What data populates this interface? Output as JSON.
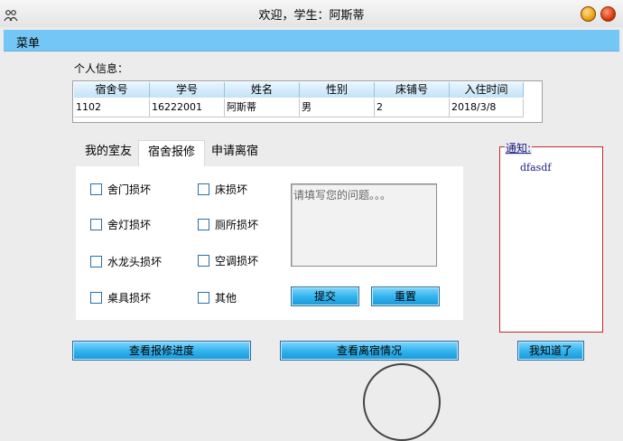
{
  "window": {
    "title": "欢迎，学生：阿斯蒂"
  },
  "menu": {
    "label": "菜单"
  },
  "personal_info": {
    "label": "个人信息：",
    "columns": [
      "宿舍号",
      "学号",
      "姓名",
      "性别",
      "床铺号",
      "入住时间"
    ],
    "row": [
      "1102",
      "16222001",
      "阿斯蒂",
      "男",
      "2",
      "2018/3/8"
    ]
  },
  "tabs": [
    "我的室友",
    "宿舍报修",
    "申请离宿"
  ],
  "active_tab": 1,
  "repair_options": [
    "舍门损坏",
    "床损坏",
    "舍灯损坏",
    "厕所损坏",
    "水龙头损坏",
    "空调损坏",
    "桌具损坏",
    "其他"
  ],
  "problem_input": {
    "placeholder": "请填写您的问题。。。"
  },
  "buttons": {
    "submit": "提交",
    "reset": "重置",
    "view_repair": "查看报修进度",
    "view_leave": "查看离宿情况",
    "acknowledge": "我知道了"
  },
  "notice": {
    "title": "通知:",
    "content": "dfasdf"
  }
}
